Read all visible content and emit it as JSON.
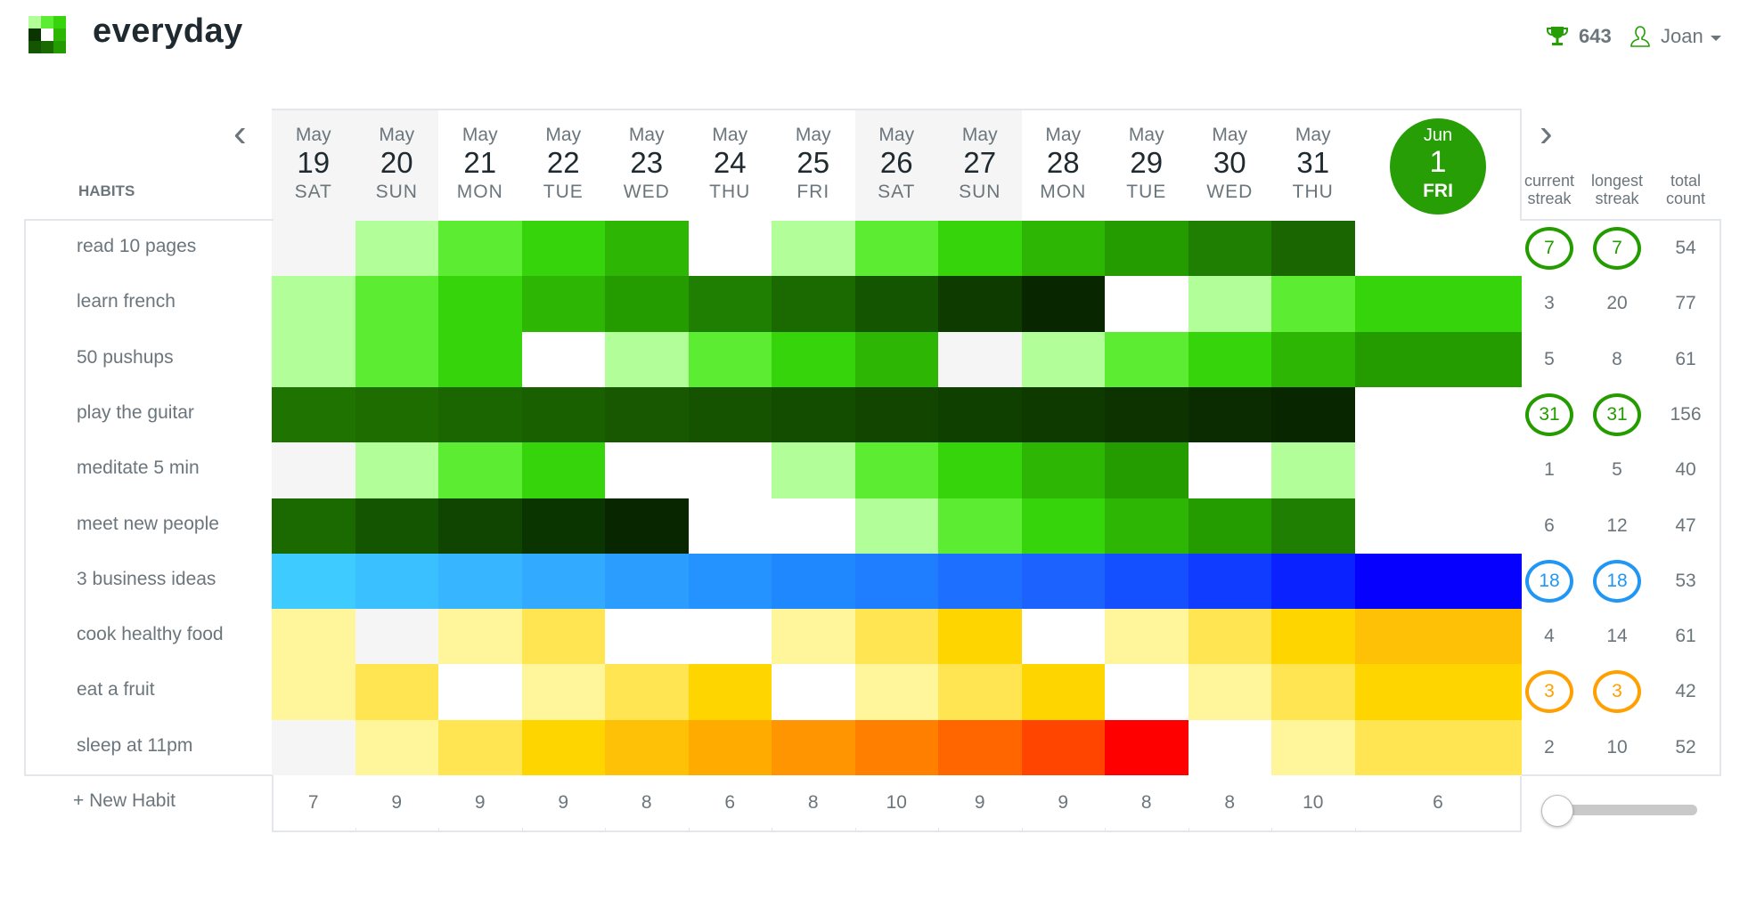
{
  "app": {
    "brand": "everyday",
    "logo_colors": [
      "#b2fe98",
      "#5ced33",
      "#36d40a",
      "#0b3500",
      "#ffffff",
      "#2db704",
      "#135501",
      "#1a6901",
      "#249c00"
    ]
  },
  "topbar": {
    "points": "643",
    "trophy_icon": "trophy-icon",
    "user_icon": "user-icon",
    "username": "Joan"
  },
  "nav": {
    "prev": "‹",
    "next": "›"
  },
  "habits_label": "HABITS",
  "dates": [
    {
      "month": "May",
      "day": "19",
      "weekday": "SAT",
      "weekend": true
    },
    {
      "month": "May",
      "day": "20",
      "weekday": "SUN",
      "weekend": true
    },
    {
      "month": "May",
      "day": "21",
      "weekday": "MON",
      "weekend": false
    },
    {
      "month": "May",
      "day": "22",
      "weekday": "TUE",
      "weekend": false
    },
    {
      "month": "May",
      "day": "23",
      "weekday": "WED",
      "weekend": false
    },
    {
      "month": "May",
      "day": "24",
      "weekday": "THU",
      "weekend": false
    },
    {
      "month": "May",
      "day": "25",
      "weekday": "FRI",
      "weekend": false
    },
    {
      "month": "May",
      "day": "26",
      "weekday": "SAT",
      "weekend": true
    },
    {
      "month": "May",
      "day": "27",
      "weekday": "SUN",
      "weekend": true
    },
    {
      "month": "May",
      "day": "28",
      "weekday": "MON",
      "weekend": false
    },
    {
      "month": "May",
      "day": "29",
      "weekday": "TUE",
      "weekend": false
    },
    {
      "month": "May",
      "day": "30",
      "weekday": "WED",
      "weekend": false
    },
    {
      "month": "May",
      "day": "31",
      "weekday": "THU",
      "weekend": false
    }
  ],
  "today": {
    "month": "Jun",
    "day": "1",
    "weekday": "FRI",
    "color": "#279e06"
  },
  "stats_headers": {
    "current": "current streak",
    "longest": "longest streak",
    "total": "total count"
  },
  "habits": [
    {
      "name": "read 10 pages",
      "current": "7",
      "longest": "7",
      "total": "54",
      "circled": true,
      "accent": "#249c00",
      "cells": [
        "#f5f5f5",
        "#b2fe98",
        "#5ced33",
        "#36d40a",
        "#2db704",
        "#ffffff",
        "#b2fe98",
        "#5ced33",
        "#36d40a",
        "#2db704",
        "#249c00",
        "#1f7f03",
        "#1a6600",
        "#ffffff"
      ]
    },
    {
      "name": "learn french",
      "current": "3",
      "longest": "20",
      "total": "77",
      "circled": false,
      "cells": [
        "#b2fe98",
        "#5ced33",
        "#36d40a",
        "#2db704",
        "#249c00",
        "#1f7f03",
        "#1a6901",
        "#135501",
        "#0e3c00",
        "#082600",
        "#ffffff",
        "#b2fe98",
        "#5ced33",
        "#36d40a"
      ]
    },
    {
      "name": "50 pushups",
      "current": "5",
      "longest": "8",
      "total": "61",
      "circled": false,
      "cells": [
        "#b2fe98",
        "#5ced33",
        "#36d40a",
        "#ffffff",
        "#b2fe98",
        "#5ced33",
        "#36d40a",
        "#2db704",
        "#f5f5f5",
        "#b2fe98",
        "#5ced33",
        "#36d40a",
        "#2db704",
        "#249c00"
      ]
    },
    {
      "name": "play the guitar",
      "current": "31",
      "longest": "31",
      "total": "156",
      "circled": true,
      "accent": "#249c00",
      "cells": [
        "#1f7300",
        "#1d6d00",
        "#1b6600",
        "#196000",
        "#175800",
        "#155300",
        "#134d00",
        "#124600",
        "#104000",
        "#0e3a00",
        "#0c3300",
        "#0a2c00",
        "#082600",
        "#ffffff"
      ]
    },
    {
      "name": "meditate 5 min",
      "current": "1",
      "longest": "5",
      "total": "40",
      "circled": false,
      "cells": [
        "#f5f5f5",
        "#b2fe98",
        "#5ced33",
        "#36d40a",
        "#ffffff",
        "#ffffff",
        "#b2fe98",
        "#5ced33",
        "#36d40a",
        "#2db704",
        "#249c00",
        "#ffffff",
        "#b2fe98",
        "#ffffff"
      ]
    },
    {
      "name": "meet new people",
      "current": "6",
      "longest": "12",
      "total": "47",
      "circled": false,
      "cells": [
        "#1a6901",
        "#135501",
        "#0f4501",
        "#0b3500",
        "#082600",
        "#ffffff",
        "#ffffff",
        "#b2fe98",
        "#5ced33",
        "#36d40a",
        "#2db704",
        "#249c00",
        "#1f7f03",
        "#ffffff"
      ]
    },
    {
      "name": "3 business ideas",
      "current": "18",
      "longest": "18",
      "total": "53",
      "circled": true,
      "accent": "#2196f3",
      "cells": [
        "#3ecbff",
        "#3bc0ff",
        "#38b5ff",
        "#31aaff",
        "#2a9dff",
        "#2493ff",
        "#2088ff",
        "#1f7eff",
        "#1d70ff",
        "#1b62ff",
        "#1450ff",
        "#103cff",
        "#0a22ff",
        "#0600ff"
      ]
    },
    {
      "name": "cook healthy food",
      "current": "4",
      "longest": "14",
      "total": "61",
      "circled": false,
      "cells": [
        "#fff59a",
        "#f5f5f5",
        "#fff59a",
        "#ffe552",
        "#ffffff",
        "#ffffff",
        "#fff59a",
        "#ffe552",
        "#ffd500",
        "#ffffff",
        "#fff59a",
        "#ffe552",
        "#ffd500",
        "#ffc106"
      ]
    },
    {
      "name": "eat a fruit",
      "current": "3",
      "longest": "3",
      "total": "42",
      "circled": true,
      "accent": "#ff9f00",
      "cells": [
        "#fff59a",
        "#ffe552",
        "#ffffff",
        "#fff59a",
        "#ffe552",
        "#ffd500",
        "#ffffff",
        "#fff59a",
        "#ffe552",
        "#ffd500",
        "#ffffff",
        "#fff59a",
        "#ffe552",
        "#ffd500"
      ]
    },
    {
      "name": "sleep at 11pm",
      "current": "2",
      "longest": "10",
      "total": "52",
      "circled": false,
      "cells": [
        "#f5f5f5",
        "#fff59a",
        "#ffe552",
        "#ffd500",
        "#ffc107",
        "#ffab00",
        "#ff9500",
        "#ff7f00",
        "#ff6600",
        "#ff4500",
        "#ff0000",
        "#ffffff",
        "#fff59a",
        "#ffe552"
      ]
    }
  ],
  "daily_counts": [
    "7",
    "9",
    "9",
    "9",
    "8",
    "6",
    "8",
    "10",
    "9",
    "9",
    "8",
    "8",
    "10",
    "6"
  ],
  "new_habit": "+ New Habit",
  "zoom_slider": {
    "value": 0
  }
}
